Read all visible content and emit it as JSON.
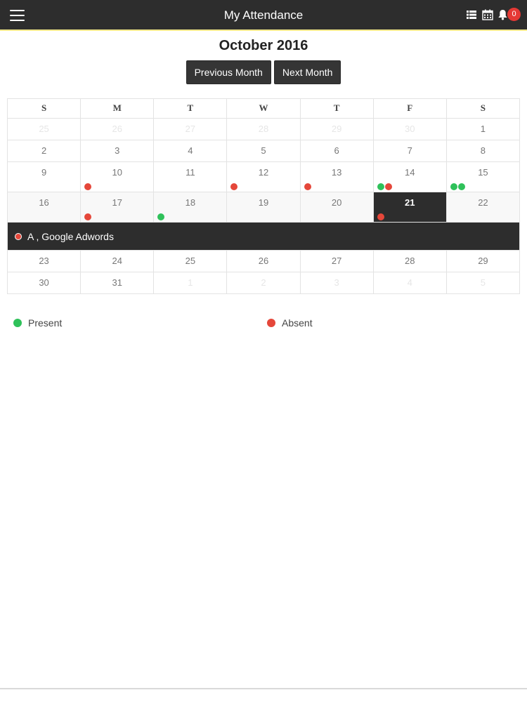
{
  "header": {
    "title": "My Attendance",
    "notification_count": "0",
    "icons": [
      "menu-icon",
      "list-view-icon",
      "calendar-icon",
      "bell-icon"
    ]
  },
  "calendar": {
    "month_title": "October 2016",
    "prev_label": "Previous Month",
    "next_label": "Next Month",
    "weekdays": [
      "S",
      "M",
      "T",
      "W",
      "T",
      "F",
      "S"
    ],
    "weeks": [
      [
        {
          "day": "25",
          "other": true
        },
        {
          "day": "26",
          "other": true
        },
        {
          "day": "27",
          "other": true
        },
        {
          "day": "28",
          "other": true
        },
        {
          "day": "29",
          "other": true
        },
        {
          "day": "30",
          "other": true
        },
        {
          "day": "1"
        }
      ],
      [
        {
          "day": "2"
        },
        {
          "day": "3"
        },
        {
          "day": "4"
        },
        {
          "day": "5"
        },
        {
          "day": "6"
        },
        {
          "day": "7"
        },
        {
          "day": "8"
        }
      ],
      [
        {
          "day": "9"
        },
        {
          "day": "10",
          "marks": [
            "absent"
          ]
        },
        {
          "day": "11"
        },
        {
          "day": "12",
          "marks": [
            "absent"
          ]
        },
        {
          "day": "13",
          "marks": [
            "absent"
          ]
        },
        {
          "day": "14",
          "marks": [
            "present",
            "absent"
          ]
        },
        {
          "day": "15",
          "marks": [
            "present",
            "present"
          ]
        }
      ],
      [
        {
          "day": "16"
        },
        {
          "day": "17",
          "marks": [
            "absent"
          ]
        },
        {
          "day": "18",
          "marks": [
            "present"
          ]
        },
        {
          "day": "19"
        },
        {
          "day": "20"
        },
        {
          "day": "21",
          "selected": true,
          "marks": [
            "absent"
          ]
        },
        {
          "day": "22"
        }
      ],
      [
        {
          "day": "23"
        },
        {
          "day": "24"
        },
        {
          "day": "25"
        },
        {
          "day": "26"
        },
        {
          "day": "27"
        },
        {
          "day": "28"
        },
        {
          "day": "29"
        }
      ],
      [
        {
          "day": "30"
        },
        {
          "day": "31"
        },
        {
          "day": "1",
          "other": true
        },
        {
          "day": "2",
          "other": true
        },
        {
          "day": "3",
          "other": true
        },
        {
          "day": "4",
          "other": true
        },
        {
          "day": "5",
          "other": true
        }
      ]
    ],
    "detail": {
      "text": "A , Google Adwords",
      "status": "absent"
    }
  },
  "legend": {
    "present_label": "Present",
    "absent_label": "Absent"
  },
  "colors": {
    "present": "#2fc15a",
    "absent": "#e5473a",
    "header_bg": "#2d2d2d",
    "badge": "#e53935"
  }
}
